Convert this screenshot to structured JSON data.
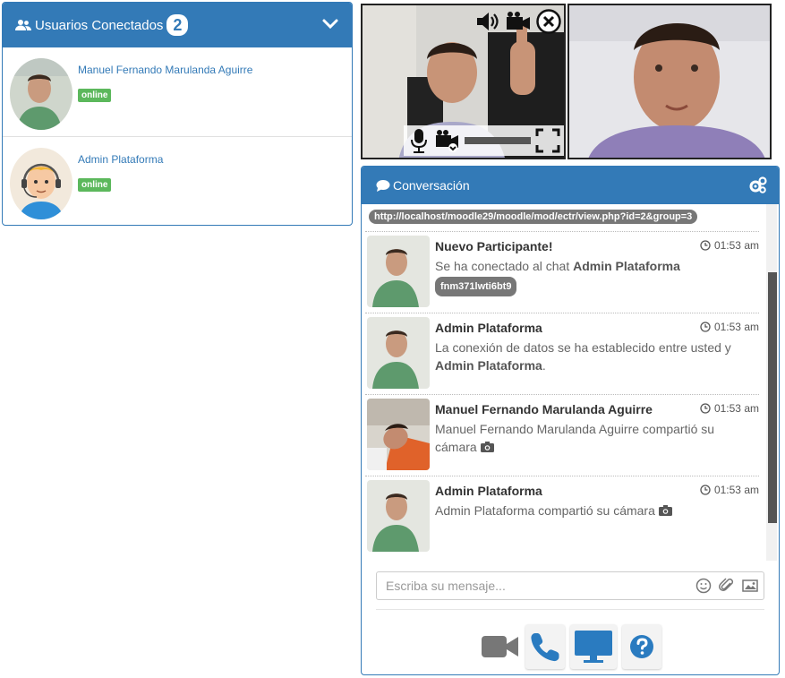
{
  "users_panel": {
    "title": "Usuarios Conectados",
    "count": "2",
    "users": [
      {
        "name": "Manuel Fernando Marulanda Aguirre",
        "status": "online"
      },
      {
        "name": "Admin Plataforma",
        "status": "online"
      }
    ]
  },
  "chat": {
    "title": "Conversación",
    "url_link": "http://localhost/moodle29/moodle/mod/ectr/view.php?id=2&group=3",
    "messages": [
      {
        "author": "Nuevo Participante!",
        "time": "01:53 am",
        "text_before": "Se ha conectado al chat ",
        "text_bold": "Admin Plataforma",
        "text_after": "",
        "pill": "fnm371lwti6bt9"
      },
      {
        "author": "Admin Plataforma",
        "time": "01:53 am",
        "text_before": "La conexión de datos se ha establecido entre usted y ",
        "text_bold": "Admin Plataforma",
        "text_after": "."
      },
      {
        "author": "Manuel Fernando Marulanda Aguirre",
        "time": "01:53 am",
        "text_before": "Manuel Fernando Marulanda Aguirre compartió su cámara",
        "text_bold": "",
        "text_after": ""
      },
      {
        "author": "Admin Plataforma",
        "time": "01:53 am",
        "text_before": "Admin Plataforma compartió su cámara",
        "text_bold": "",
        "text_after": ""
      }
    ],
    "input_placeholder": "Escriba su mensaje..."
  },
  "colors": {
    "primary": "#337ab7",
    "online": "#5cb85c",
    "pill": "#777777"
  },
  "icons": [
    "users-icon",
    "chevron-down-icon",
    "speaker-icon",
    "camera-icon",
    "close-icon",
    "microphone-icon",
    "camera-off-icon",
    "fullscreen-icon",
    "comment-icon",
    "gears-icon",
    "clock-icon",
    "smiley-icon",
    "paperclip-icon",
    "image-icon",
    "video-call-icon",
    "phone-icon",
    "screen-share-icon",
    "help-icon"
  ]
}
